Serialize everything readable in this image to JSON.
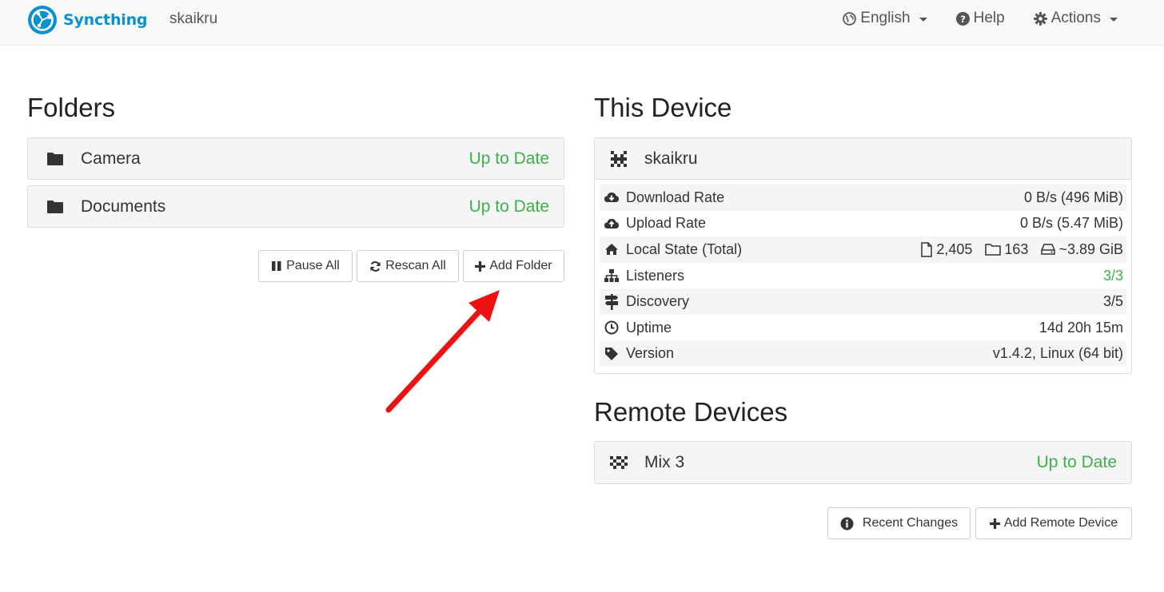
{
  "navbar": {
    "brand": "Syncthing",
    "hostname": "skaikru",
    "language": "English",
    "help": "Help",
    "actions": "Actions"
  },
  "folders": {
    "heading": "Folders",
    "items": [
      {
        "name": "Camera",
        "status": "Up to Date"
      },
      {
        "name": "Documents",
        "status": "Up to Date"
      }
    ],
    "buttons": {
      "pause_all": "Pause All",
      "rescan_all": "Rescan All",
      "add_folder": "Add Folder"
    }
  },
  "this_device": {
    "heading": "This Device",
    "name": "skaikru",
    "rows": [
      {
        "label": "Download Rate",
        "value": "0 B/s (496 MiB)",
        "icon": "cloud-download-icon"
      },
      {
        "label": "Upload Rate",
        "value": "0 B/s (5.47 MiB)",
        "icon": "cloud-upload-icon"
      },
      {
        "label": "Local State (Total)",
        "icon": "home-icon",
        "files": "2,405",
        "dirs": "163",
        "size": "~3.89 GiB"
      },
      {
        "label": "Listeners",
        "value": "3/3",
        "icon": "sitemap-icon"
      },
      {
        "label": "Discovery",
        "value": "3/5",
        "icon": "signpost-icon"
      },
      {
        "label": "Uptime",
        "value": "14d 20h 15m",
        "icon": "clock-icon"
      },
      {
        "label": "Version",
        "value": "v1.4.2, Linux (64 bit)",
        "icon": "tag-icon"
      }
    ]
  },
  "remote_devices": {
    "heading": "Remote Devices",
    "items": [
      {
        "name": "Mix 3",
        "status": "Up to Date"
      }
    ],
    "buttons": {
      "recent_changes": "Recent Changes",
      "add_remote_device": "Add Remote Device"
    }
  },
  "colors": {
    "brand": "#0891d1",
    "ok": "#3cb14a",
    "arrow": "#ee1111"
  }
}
